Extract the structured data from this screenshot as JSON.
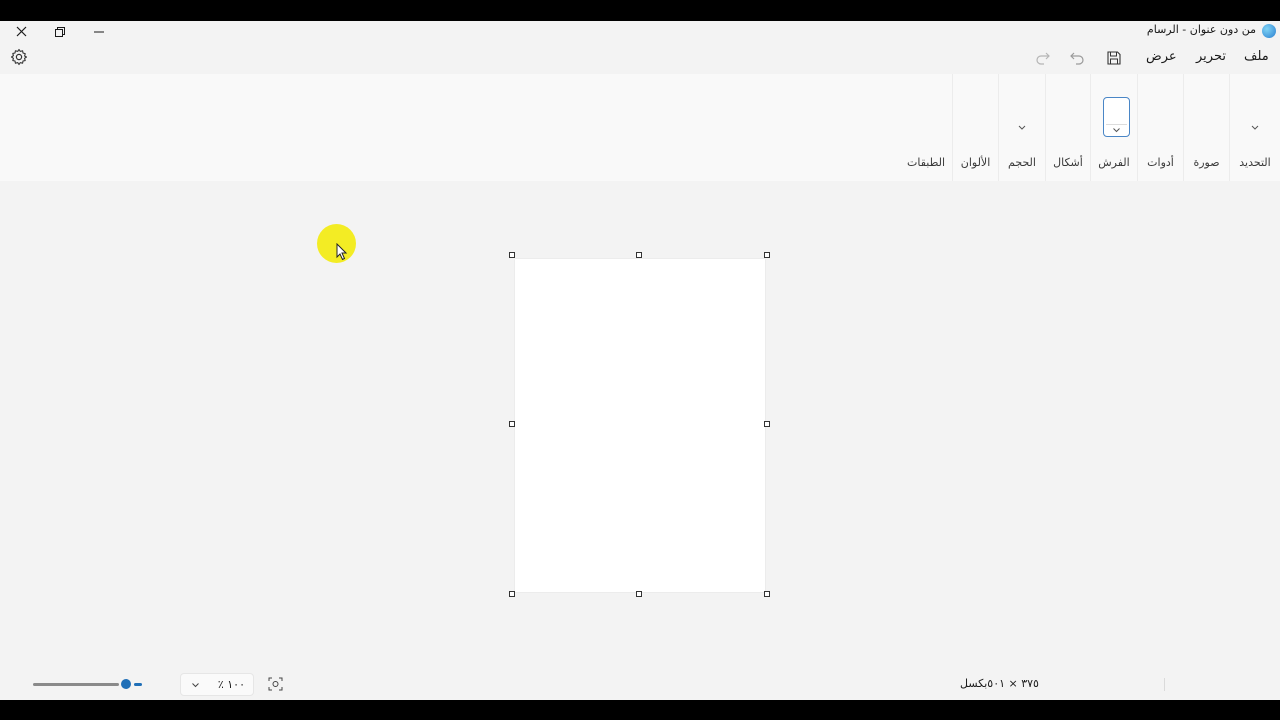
{
  "window": {
    "title": "من دون عنوان - الرسام",
    "app_icon": "paint-palette-icon"
  },
  "title_controls": {
    "close": "close-icon",
    "restore": "restore-icon",
    "minimize": "minimize-icon"
  },
  "menu": {
    "file": "ملف",
    "edit": "تحرير",
    "view": "عرض"
  },
  "toolbar": {
    "save": "save-icon",
    "undo": "undo-icon",
    "redo": "redo-icon",
    "settings": "gear-icon"
  },
  "ribbon": {
    "selection": "التحديد",
    "image": "صورة",
    "tools": "أدوات",
    "brushes": "الفرش",
    "shapes": "أشكال",
    "size": "الحجم",
    "colors": "الألوان",
    "layers": "الطبقات"
  },
  "status": {
    "zoom_value": "١٠٠ ٪",
    "canvas_size": "٣٧٥ × ٥٠١بكسل",
    "zoom_slider_level": 0.85
  },
  "colors": {
    "accent": "#1f6fb7",
    "cursor_highlight": "#f3ec12",
    "canvas": "#ffffff"
  }
}
